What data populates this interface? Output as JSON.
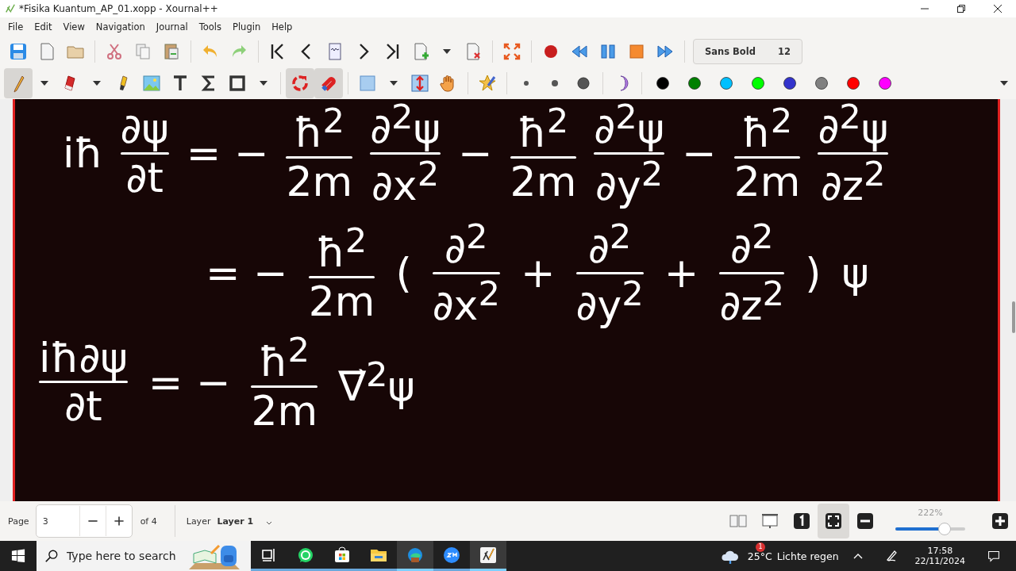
{
  "window": {
    "title": "*Fisika Kuantum_AP_01.xopp - Xournal++"
  },
  "menu": [
    "File",
    "Edit",
    "View",
    "Navigation",
    "Journal",
    "Tools",
    "Plugin",
    "Help"
  ],
  "font_button": {
    "family": "Sans Bold",
    "size": "12"
  },
  "tools": {
    "pen_selected": true,
    "rotation_snap_on": true,
    "grid_snap_on": true
  },
  "colors": [
    {
      "color": "#000000"
    },
    {
      "color": "#008000"
    },
    {
      "color": "#00c0ff"
    },
    {
      "color": "#00ff00"
    },
    {
      "color": "#3333cc"
    },
    {
      "color": "#808080"
    },
    {
      "color": "#ff0000"
    },
    {
      "color": "#ff00ff"
    }
  ],
  "equations": [
    [
      {
        "kind": "op",
        "text": "iħ"
      },
      {
        "kind": "frac",
        "num": "∂ψ",
        "den": "∂t"
      },
      {
        "kind": "op",
        "text": "= −"
      },
      {
        "kind": "frac",
        "num": "ħ$^{2}$",
        "den": "2m"
      },
      {
        "kind": "frac",
        "num": "∂$^{2}$ψ",
        "den": "∂x$^{2}$"
      },
      {
        "kind": "op",
        "text": "−"
      },
      {
        "kind": "frac",
        "num": "ħ$^{2}$",
        "den": "2m"
      },
      {
        "kind": "frac",
        "num": "∂$^{2}$ψ",
        "den": "∂y$^{2}$"
      },
      {
        "kind": "op",
        "text": "−"
      },
      {
        "kind": "frac",
        "num": "ħ$^{2}$",
        "den": "2m"
      },
      {
        "kind": "frac",
        "num": "∂$^{2}$ψ",
        "den": "∂z$^{2}$"
      }
    ],
    [
      {
        "kind": "op",
        "text": "= −"
      },
      {
        "kind": "frac",
        "num": "ħ$^{2}$",
        "den": "2m"
      },
      {
        "kind": "op",
        "text": "("
      },
      {
        "kind": "frac",
        "num": "∂$^{2}$",
        "den": "∂x$^{2}$"
      },
      {
        "kind": "op",
        "text": "+"
      },
      {
        "kind": "frac",
        "num": "∂$^{2}$",
        "den": "∂y$^{2}$"
      },
      {
        "kind": "op",
        "text": "+"
      },
      {
        "kind": "frac",
        "num": "∂$^{2}$",
        "den": "∂z$^{2}$"
      },
      {
        "kind": "op",
        "text": ")"
      },
      {
        "kind": "op",
        "text": "ψ"
      }
    ],
    [
      {
        "kind": "frac",
        "num": "iħ∂ψ",
        "den": "∂t"
      },
      {
        "kind": "op",
        "text": "= −"
      },
      {
        "kind": "frac",
        "num": "ħ$^{2}$",
        "den": "2m"
      },
      {
        "kind": "op",
        "text": "∇⃗$^{2}$ψ"
      }
    ]
  ],
  "status_bar": {
    "page_label": "Page",
    "page_value": "3",
    "page_count": "of 4",
    "layer_label": "Layer",
    "layer_value": "Layer 1",
    "zoom": "222%",
    "zoom_slider": {
      "level": 0.7
    },
    "fit_selected": true
  },
  "taskbar": {
    "search_placeholder": "Type here to search",
    "apps": [
      {
        "kind": "taskview",
        "active": false
      },
      {
        "kind": "whatsapp",
        "active": false
      },
      {
        "kind": "store",
        "active": false
      },
      {
        "kind": "explorer",
        "active": false
      },
      {
        "kind": "edge",
        "active": true
      },
      {
        "kind": "zoom",
        "active": false
      },
      {
        "kind": "xournal",
        "active": true
      }
    ],
    "weather_badge": "1",
    "temperature": "25°C",
    "weather": "Lichte regen",
    "time": "17:58",
    "date": "22/11/2024"
  }
}
